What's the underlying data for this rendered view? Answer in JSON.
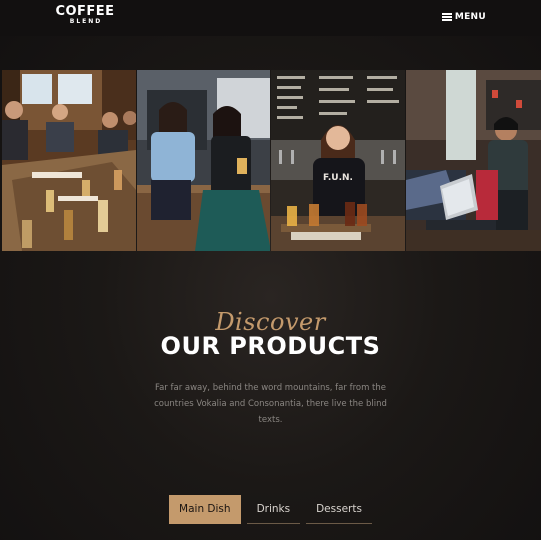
{
  "brand": {
    "name": "COFFEE",
    "tagline": "BLEND"
  },
  "nav": {
    "menu_label": "MENU",
    "menu_icon": "hamburger-icon"
  },
  "gallery": {
    "photos": [
      {
        "subject": "group of people drinking around a table"
      },
      {
        "subject": "two women laughing at a bar"
      },
      {
        "subject": "woman behind bar with beer flight"
      },
      {
        "subject": "people with laptop in a cafe"
      }
    ]
  },
  "products": {
    "script_heading": "Discover",
    "title": "OUR PRODUCTS",
    "intro": "Far far away, behind the word mountains, far from the countries Vokalia and Consonantia, there live the blind texts."
  },
  "tabs": [
    {
      "label": "Main Dish",
      "active": true
    },
    {
      "label": "Drinks",
      "active": false
    },
    {
      "label": "Desserts",
      "active": false
    }
  ],
  "colors": {
    "accent": "#c49a6c",
    "background": "#141111",
    "text": "#ffffff",
    "muted_text": "#8a8682"
  }
}
